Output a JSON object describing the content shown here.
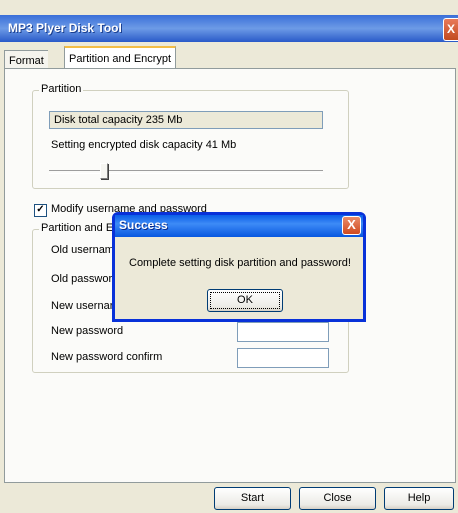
{
  "window": {
    "title": "MP3 Plyer Disk Tool",
    "close_glyph": "X"
  },
  "tabs": [
    {
      "label": "Format"
    },
    {
      "label": "Partition and Encrypt"
    }
  ],
  "partition": {
    "group_title": "Partition",
    "total_capacity": "Disk total capacity 235 Mb",
    "encrypted_capacity": "Setting encrypted disk capacity 41 Mb",
    "slider_fraction": 0.2
  },
  "modify": {
    "label": "Modify username and password",
    "checked": true,
    "check_glyph": "✓"
  },
  "credentials": {
    "group_title": "Partition and E",
    "old_username": "Old usernam",
    "old_password": "Old passwor",
    "new_username": "New usernar",
    "new_password": "New password",
    "new_password_confirm": "New password confirm"
  },
  "buttons": {
    "start": "Start",
    "close": "Close",
    "help": "Help"
  },
  "dialog": {
    "title": "Success",
    "message": "Complete setting disk partition and password!",
    "ok": "OK",
    "close_glyph": "X"
  },
  "colors": {
    "title_bar": "#3a6fd8",
    "dialog_border": "#0831d9",
    "close_button": "#d04a1f",
    "window_bg": "#ece9d8"
  }
}
